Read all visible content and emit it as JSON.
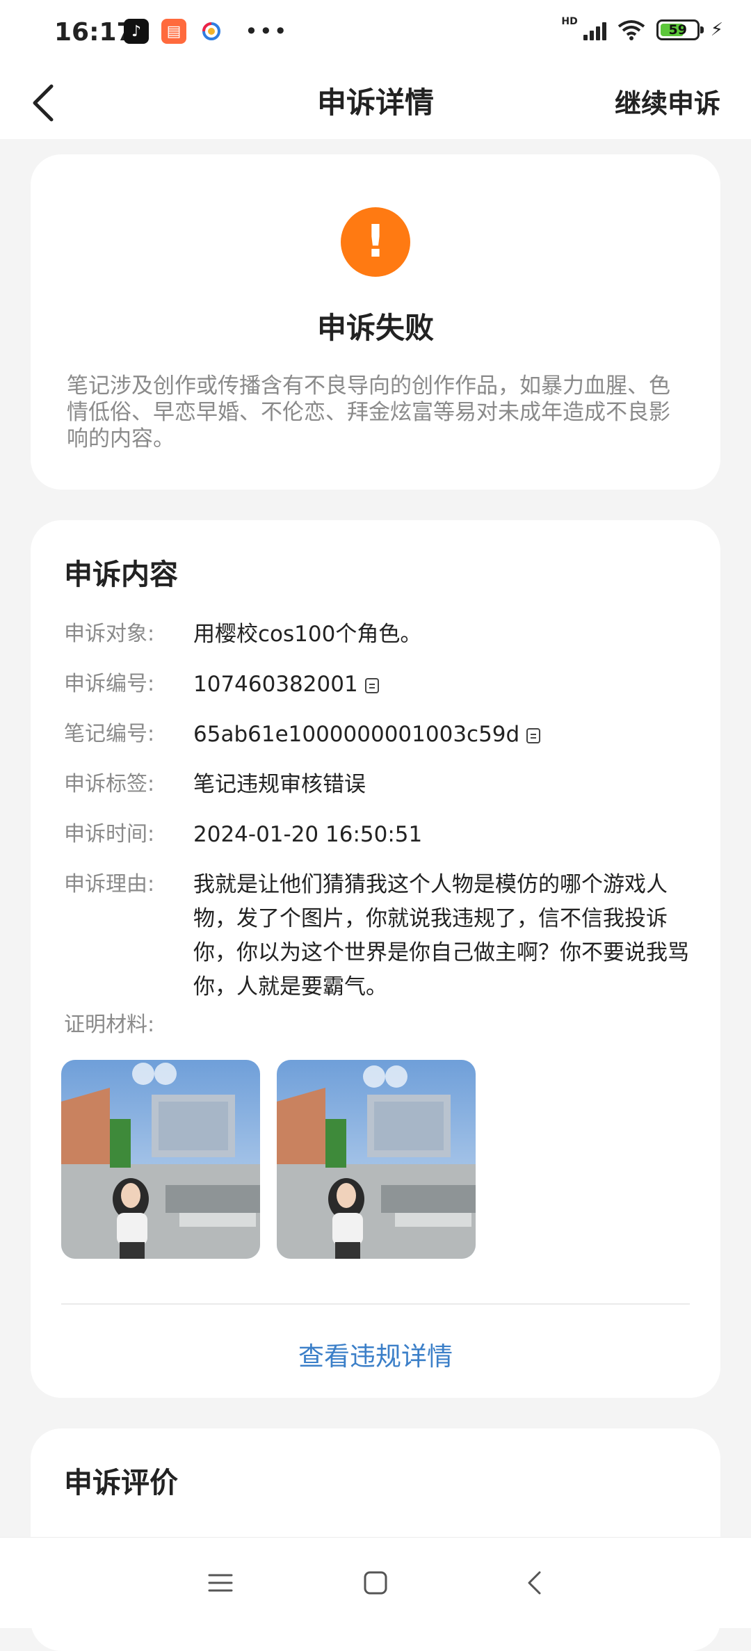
{
  "status_bar": {
    "time": "16:17",
    "hd": "HD",
    "battery": "59",
    "icons": [
      "tiktok-app-icon",
      "shopping-app-icon",
      "browser-app-icon",
      "more-dots-icon",
      "signal-icon",
      "wifi-icon",
      "battery-icon",
      "charging-icon"
    ]
  },
  "header": {
    "title": "申诉详情",
    "action": "继续申诉"
  },
  "status": {
    "title": "申诉失败",
    "icon": "!",
    "description": "笔记涉及创作或传播含有不良导向的创作作品，如暴力血腥、色情低俗、早恋早婚、不伦恋、拜金炫富等易对未成年造成不良影响的内容。",
    "color": "#ff7a12"
  },
  "content": {
    "heading": "申诉内容",
    "rows": [
      {
        "label": "申诉对象:",
        "value": "用樱校cos100个角色。"
      },
      {
        "label": "申诉编号:",
        "value": "107460382001"
      },
      {
        "label": "笔记编号:",
        "value": "65ab61e1000000001003c59d"
      },
      {
        "label": "申诉标签:",
        "value": "笔记违规审核错误"
      },
      {
        "label": "申诉时间:",
        "value": "2024-01-20 16:50:51"
      },
      {
        "label": "申诉理由:",
        "value": "我就是让他们猜猜我这个人物是模仿的哪个游戏人物，发了个图片，你就说我违规了，信不信我投诉你，你以为这个世界是你自己做主啊？你不要说我骂你，人就是要霸气。"
      }
    ],
    "proof_label": "证明材料:",
    "view_violation": "查看违规详情",
    "link_color": "#3b7fc8"
  },
  "evaluation": {
    "heading": "申诉评价"
  }
}
